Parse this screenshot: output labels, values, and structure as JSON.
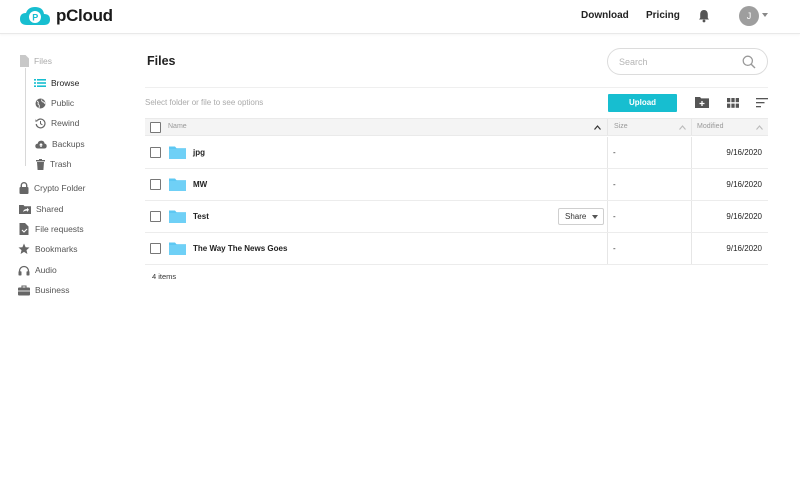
{
  "header": {
    "logo_text": "pCloud",
    "nav": [
      "Download",
      "Pricing"
    ],
    "avatar_initial": "J"
  },
  "sidebar": {
    "items": [
      {
        "label": "Files",
        "icon": "file-icon"
      },
      {
        "label": "Browse",
        "icon": "list-icon"
      },
      {
        "label": "Public",
        "icon": "globe-icon"
      },
      {
        "label": "Rewind",
        "icon": "history-icon"
      },
      {
        "label": "Backups",
        "icon": "cloud-upload-icon"
      },
      {
        "label": "Trash",
        "icon": "trash-icon"
      },
      {
        "label": "Crypto Folder",
        "icon": "lock-icon"
      },
      {
        "label": "Shared",
        "icon": "shared-folder-icon"
      },
      {
        "label": "File requests",
        "icon": "file-request-icon"
      },
      {
        "label": "Bookmarks",
        "icon": "star-icon"
      },
      {
        "label": "Audio",
        "icon": "headphones-icon"
      },
      {
        "label": "Business",
        "icon": "briefcase-icon"
      }
    ]
  },
  "main": {
    "title": "Files",
    "search_placeholder": "Search",
    "hint": "Select folder or file to see options",
    "upload_label": "Upload",
    "columns": [
      "Name",
      "Size",
      "Modified"
    ],
    "rows": [
      {
        "name": "jpg",
        "size": "-",
        "modified": "9/16/2020"
      },
      {
        "name": "MW",
        "size": "-",
        "modified": "9/16/2020"
      },
      {
        "name": "Test",
        "size": "-",
        "modified": "9/16/2020",
        "share": "Share"
      },
      {
        "name": "The Way The News Goes",
        "size": "-",
        "modified": "9/16/2020"
      }
    ],
    "count": "4 items"
  },
  "colors": {
    "accent": "#17bed0",
    "folder": "#5dc8f3"
  }
}
